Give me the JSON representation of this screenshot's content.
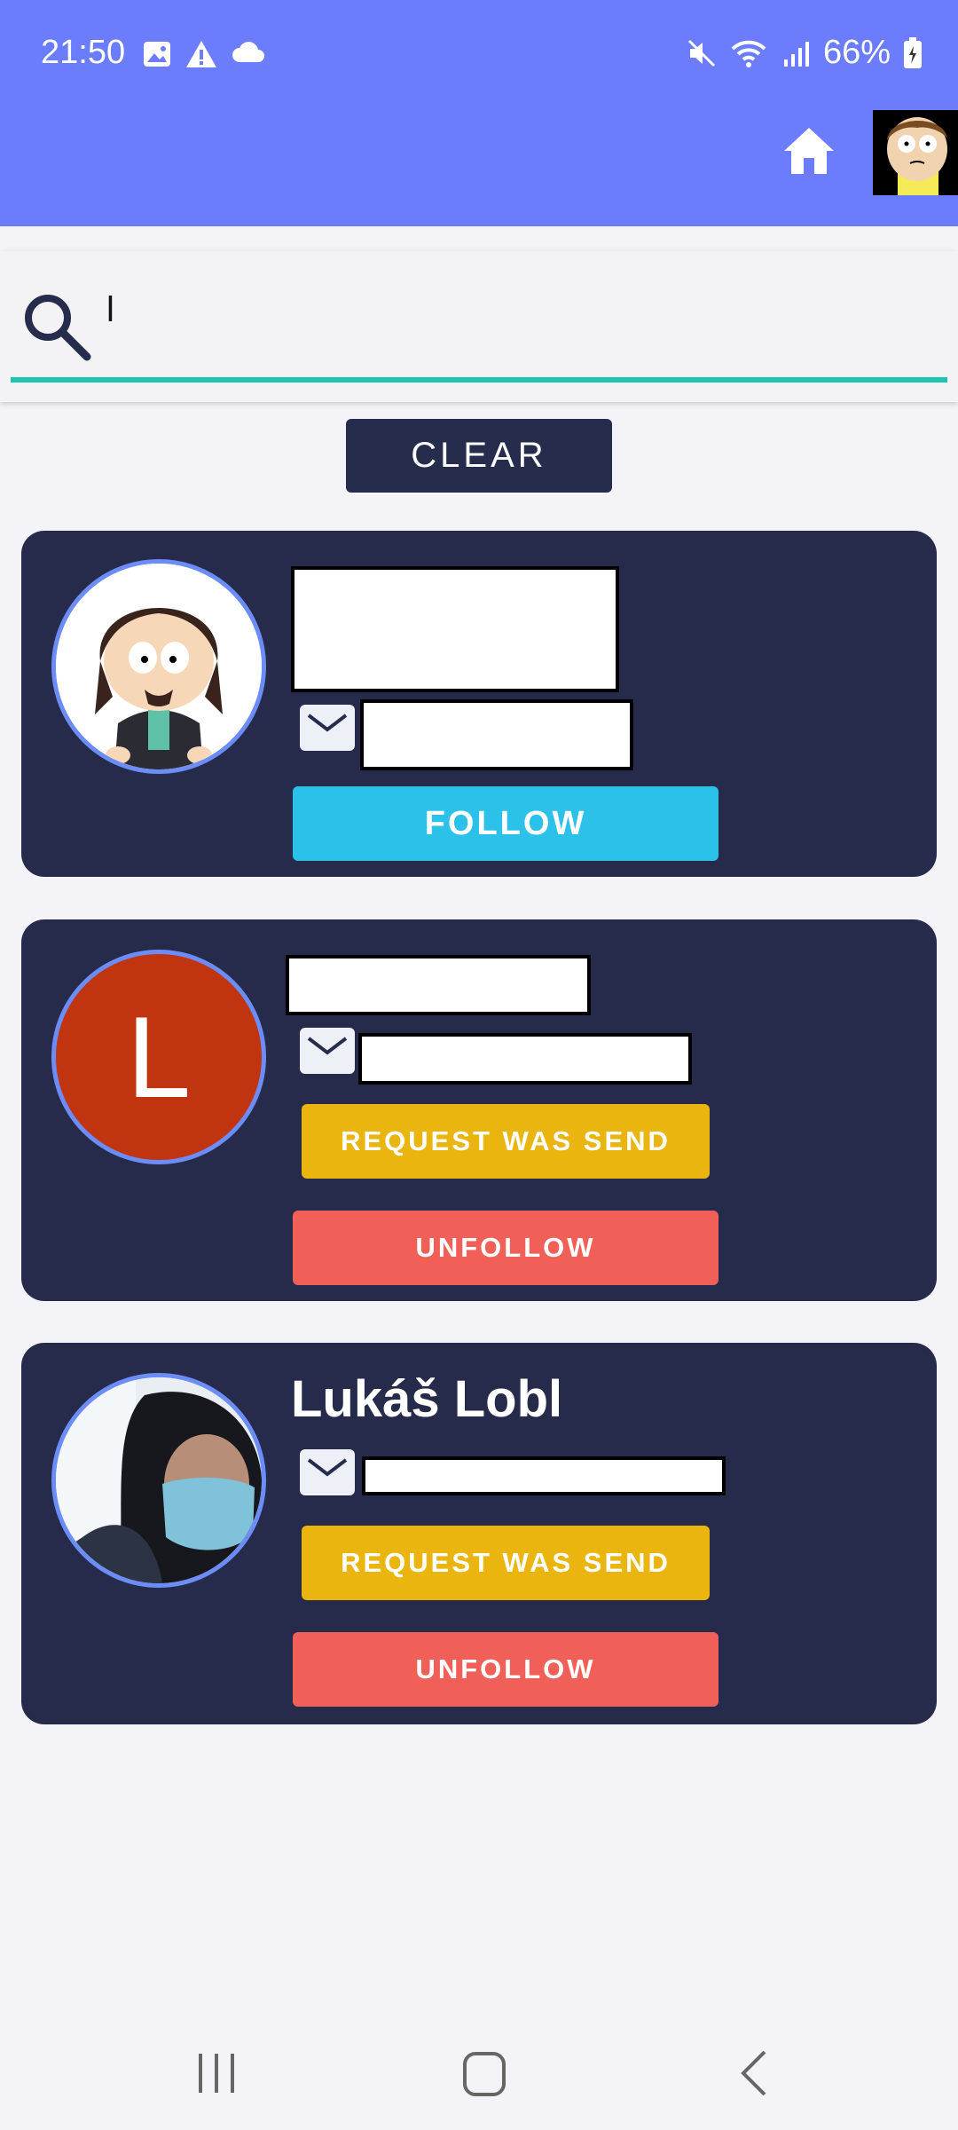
{
  "status_bar": {
    "time": "21:50",
    "battery": "66%"
  },
  "search": {
    "value": "l",
    "clear_label": "CLEAR"
  },
  "users": [
    {
      "name": "",
      "email": "",
      "avatar": "south-park-character",
      "primary_action": "FOLLOW"
    },
    {
      "name": "",
      "email": "",
      "avatar_letter": "L",
      "avatar_color": "#c0350f",
      "request_label": "REQUEST WAS SEND",
      "unfollow_label": "UNFOLLOW"
    },
    {
      "name": "Lukáš Lobl",
      "email": "",
      "avatar": "photo-masked-person",
      "request_label": "REQUEST WAS SEND",
      "unfollow_label": "UNFOLLOW"
    }
  ],
  "colors": {
    "app_bar": "#6b7cfd",
    "card": "#262b4b",
    "follow": "#2cc1e8",
    "request": "#eab50f",
    "unfollow": "#f06058",
    "accent_underline": "#1ec6b0"
  }
}
